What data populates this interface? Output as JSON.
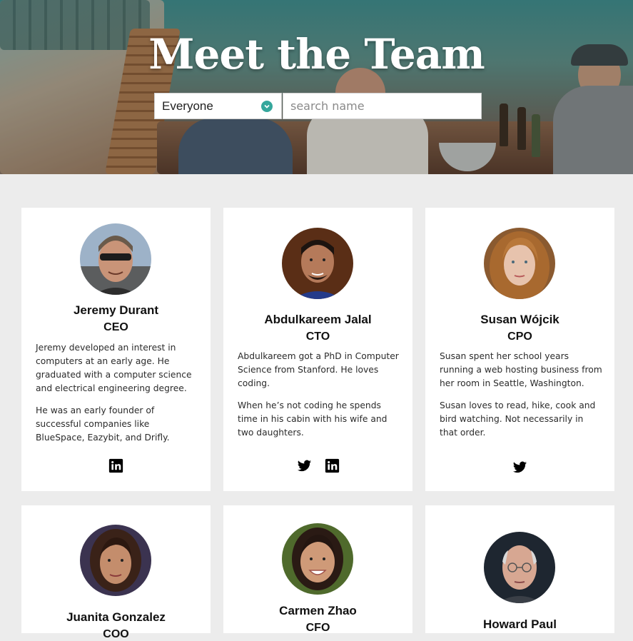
{
  "header": {
    "title": "Meet the Team",
    "filter": {
      "selected": "Everyone"
    },
    "search": {
      "placeholder": "search name",
      "value": ""
    }
  },
  "colors": {
    "accent": "#35a79c",
    "background": "#ececec",
    "card": "#ffffff"
  },
  "members": [
    {
      "name": "Jeremy Durant",
      "role": "CEO",
      "bio": [
        "Jeremy developed an interest in computers at an early age. He graduated with a computer science and electrical engineering degree.",
        "He was an early founder of successful companies like BlueSpace, Eazybit, and Drifly."
      ],
      "social": [
        "linkedin-icon"
      ]
    },
    {
      "name": "Abdulkareem Jalal",
      "role": "CTO",
      "bio": [
        "Abdulkareem got a PhD in Computer Science from Stanford. He loves coding.",
        "When he’s not coding he spends time in his cabin with his wife and two daughters."
      ],
      "social": [
        "twitter-icon",
        "linkedin-icon"
      ]
    },
    {
      "name": "Susan Wójcik",
      "role": "CPO",
      "bio": [
        "Susan spent her school years running a web hosting business from her room in Seattle, Washington.",
        "Susan loves to read, hike, cook and bird watching. Not necessarily in that order."
      ],
      "social": [
        "twitter-icon"
      ]
    },
    {
      "name": "Juanita Gonzalez",
      "role": "COO"
    },
    {
      "name": "Carmen Zhao",
      "role": "CFO"
    },
    {
      "name": "Howard Paul"
    }
  ]
}
